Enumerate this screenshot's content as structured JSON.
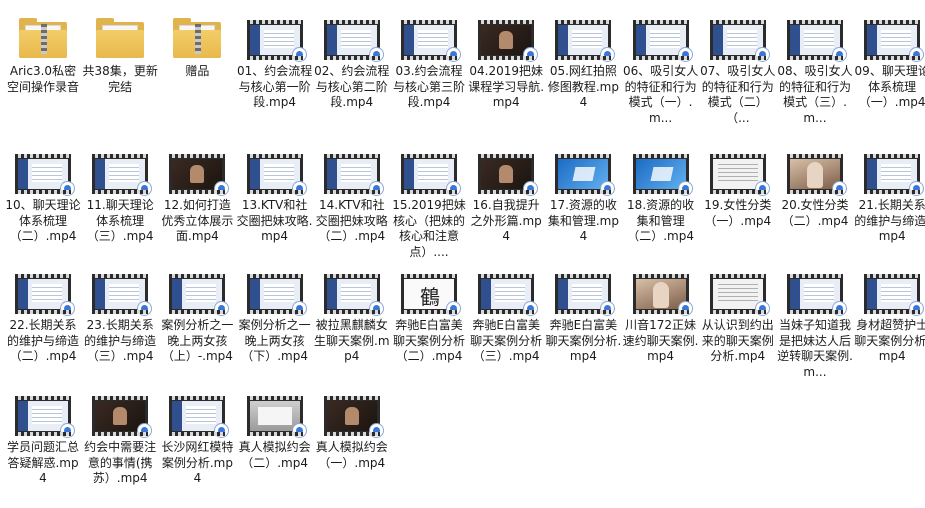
{
  "items": [
    {
      "kind": "folder",
      "style": "zip",
      "label": "Aric3.0私密空间操作录音"
    },
    {
      "kind": "folder",
      "style": "plain",
      "label": "共38集，更新完结"
    },
    {
      "kind": "folder",
      "style": "zip",
      "label": "赠品"
    },
    {
      "kind": "video",
      "thumb": "app",
      "label": "01、约会流程与核心第一阶段.mp4"
    },
    {
      "kind": "video",
      "thumb": "app",
      "label": "02、约会流程与核心第二阶段.mp4"
    },
    {
      "kind": "video",
      "thumb": "app",
      "label": "03.约会流程与核心第三阶段.mp4"
    },
    {
      "kind": "video",
      "thumb": "dark",
      "label": "04.2019把妹课程学习导航.mp4"
    },
    {
      "kind": "video",
      "thumb": "app",
      "label": "05.网红拍照修图教程.mp4"
    },
    {
      "kind": "video",
      "thumb": "app",
      "label": "06、吸引女人的特征和行为模式（一）.m..."
    },
    {
      "kind": "video",
      "thumb": "app",
      "label": "07、吸引女人的特征和行为模式（二）（..."
    },
    {
      "kind": "video",
      "thumb": "app",
      "label": "08、吸引女人的特征和行为模式（三）.m..."
    },
    {
      "kind": "video",
      "thumb": "app",
      "label": "09、聊天理论体系梳理（一）.mp4"
    },
    {
      "kind": "video",
      "thumb": "app",
      "label": "10、聊天理论体系梳理（二）.mp4"
    },
    {
      "kind": "video",
      "thumb": "app",
      "label": "11.聊天理论体系梳理（三）.mp4"
    },
    {
      "kind": "video",
      "thumb": "dark",
      "label": "12.如何打造优秀立体展示面.mp4"
    },
    {
      "kind": "video",
      "thumb": "app",
      "label": "13.KTV和社交圈把妹攻略.mp4"
    },
    {
      "kind": "video",
      "thumb": "app",
      "label": "14.KTV和社交圈把妹攻略（二）.mp4"
    },
    {
      "kind": "video",
      "thumb": "app",
      "label": "15.2019把妹核心（把妹的核心和注意点）...."
    },
    {
      "kind": "video",
      "thumb": "dark",
      "label": "16.自我提升之外形篇.mp4"
    },
    {
      "kind": "video",
      "thumb": "win",
      "label": "17.资源的收集和管理.mp4"
    },
    {
      "kind": "video",
      "thumb": "win",
      "label": "18.资源的收集和管理（二）.mp4"
    },
    {
      "kind": "video",
      "thumb": "doc",
      "label": "19.女性分类（一）.mp4"
    },
    {
      "kind": "video",
      "thumb": "photo",
      "label": "20.女性分类（二）.mp4"
    },
    {
      "kind": "video",
      "thumb": "app",
      "label": "21.长期关系的维护与缔造.mp4"
    },
    {
      "kind": "video",
      "thumb": "app",
      "label": "22.长期关系的维护与缔造（二）.mp4"
    },
    {
      "kind": "video",
      "thumb": "app",
      "label": "23.长期关系的维护与缔造（三）.mp4"
    },
    {
      "kind": "video",
      "thumb": "app",
      "label": "案例分析之一晚上两女孩（上）-.mp4"
    },
    {
      "kind": "video",
      "thumb": "app",
      "label": "案例分析之一晚上两女孩（下）.mp4"
    },
    {
      "kind": "video",
      "thumb": "app",
      "label": "被拉黑麒麟女生聊天案例.mp4"
    },
    {
      "kind": "video",
      "thumb": "sign",
      "label": "奔驰E白富美聊天案例分析（二）.mp4"
    },
    {
      "kind": "video",
      "thumb": "app",
      "label": "奔驰E白富美聊天案例分析（三）.mp4"
    },
    {
      "kind": "video",
      "thumb": "app",
      "label": "奔驰E白富美聊天案例分析.mp4"
    },
    {
      "kind": "video",
      "thumb": "photo",
      "label": "川音172正妹速约聊天案例.mp4"
    },
    {
      "kind": "video",
      "thumb": "doc",
      "label": "从认识到约出来的聊天案例分析.mp4"
    },
    {
      "kind": "video",
      "thumb": "app",
      "label": "当妹子知道我是把妹达人后逆转聊天案例.m..."
    },
    {
      "kind": "video",
      "thumb": "app",
      "label": "身材超赞护士聊天案例分析.mp4"
    },
    {
      "kind": "video",
      "thumb": "app",
      "label": "学员问题汇总答疑解惑.mp4"
    },
    {
      "kind": "video",
      "thumb": "dark",
      "label": "约会中需要注意的事情(携苏）.mp4"
    },
    {
      "kind": "video",
      "thumb": "app",
      "label": "长沙网红模特案例分析.mp4"
    },
    {
      "kind": "video",
      "thumb": "gray",
      "label": "真人模拟约会（二）.mp4"
    },
    {
      "kind": "video",
      "thumb": "dark",
      "label": "真人模拟约会（一）.mp4"
    }
  ]
}
